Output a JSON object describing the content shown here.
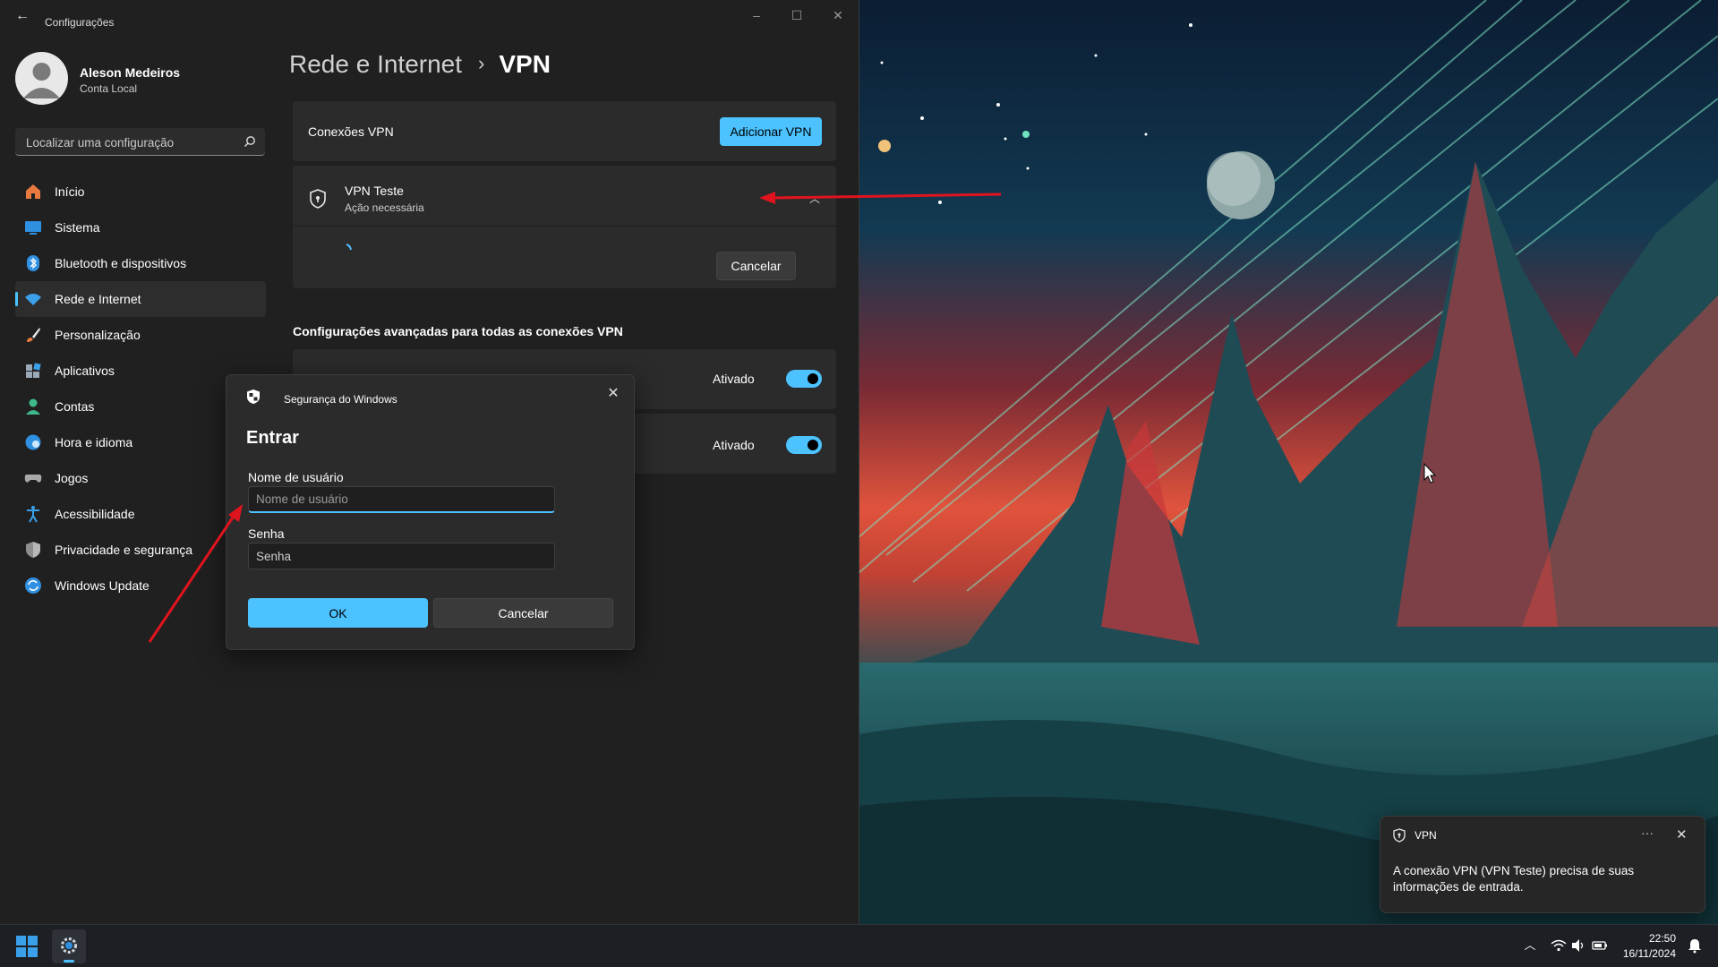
{
  "window": {
    "title": "Configurações"
  },
  "profile": {
    "name": "Aleson Medeiros",
    "subtitle": "Conta Local"
  },
  "search": {
    "placeholder": "Localizar uma configuração"
  },
  "sidebar": {
    "items": [
      {
        "label": "Início",
        "icon": "home-icon"
      },
      {
        "label": "Sistema",
        "icon": "system-icon"
      },
      {
        "label": "Bluetooth e dispositivos",
        "icon": "bluetooth-icon"
      },
      {
        "label": "Rede e Internet",
        "icon": "wifi-icon",
        "active": true
      },
      {
        "label": "Personalização",
        "icon": "brush-icon"
      },
      {
        "label": "Aplicativos",
        "icon": "apps-icon"
      },
      {
        "label": "Contas",
        "icon": "account-icon"
      },
      {
        "label": "Hora e idioma",
        "icon": "globe-clock-icon"
      },
      {
        "label": "Jogos",
        "icon": "gamepad-icon"
      },
      {
        "label": "Acessibilidade",
        "icon": "accessibility-icon"
      },
      {
        "label": "Privacidade e segurança",
        "icon": "shield-icon"
      },
      {
        "label": "Windows Update",
        "icon": "update-icon"
      }
    ]
  },
  "breadcrumb": {
    "parent": "Rede e Internet",
    "separator": "›",
    "current": "VPN"
  },
  "vpn_connections": {
    "label": "Conexões VPN",
    "add_button": "Adicionar VPN"
  },
  "vpn_item": {
    "name": "VPN Teste",
    "status": "Ação necessária",
    "cancel_button": "Cancelar"
  },
  "advanced": {
    "title": "Configurações avançadas para todas as conexões VPN",
    "toggles": [
      {
        "state_label": "Ativado",
        "on": true
      },
      {
        "state_label": "Ativado",
        "on": true
      }
    ]
  },
  "dialog": {
    "header": "Segurança do Windows",
    "title": "Entrar",
    "username_label": "Nome de usuário",
    "username_placeholder": "Nome de usuário",
    "password_label": "Senha",
    "password_placeholder": "Senha",
    "ok_button": "OK",
    "cancel_button": "Cancelar"
  },
  "notification": {
    "title": "VPN",
    "more": "···",
    "close": "✕",
    "body": "A conexão VPN (VPN Teste) precisa de suas informações de entrada."
  },
  "taskbar": {
    "time": "22:50",
    "date": "16/11/2024"
  },
  "colors": {
    "accent": "#4cc2ff",
    "window_bg": "#202020",
    "card_bg": "#2b2b2b",
    "annotation_arrow": "#e0141e"
  }
}
